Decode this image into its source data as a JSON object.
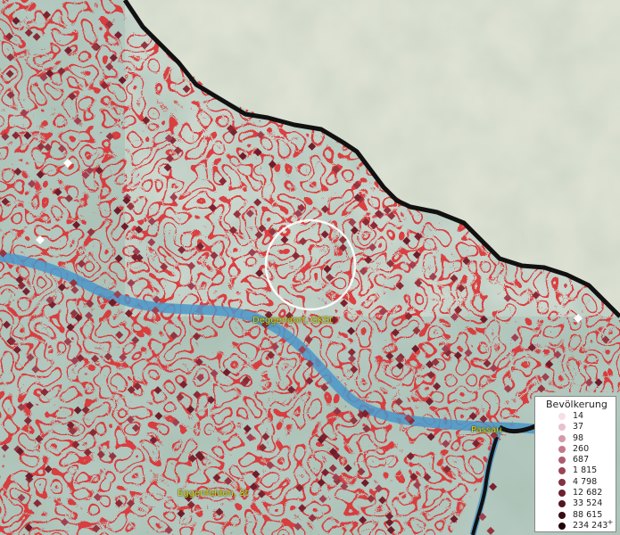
{
  "map": {
    "colors": {
      "relief_light": "#b9cbbd",
      "relief_dark": "#7f9a8e",
      "mountain_light": "#e4e0cc",
      "river": "#4a96c9",
      "boundary": "#e0282a",
      "border": "#111111",
      "marker": "#8a2a36",
      "label": "#d9d21a"
    },
    "labels": [
      {
        "id": "deggendorf",
        "text": "Deggendorf, GKSt"
      },
      {
        "id": "passau",
        "text": "Passau"
      },
      {
        "id": "eggenfelden",
        "text": "Eggenfelden, St"
      }
    ]
  },
  "legend": {
    "title": "Bevölkerung",
    "classes": [
      {
        "label": "14",
        "color": "#f7dfe6"
      },
      {
        "label": "37",
        "color": "#e9c0cc"
      },
      {
        "label": "98",
        "color": "#d59aa9"
      },
      {
        "label": "260",
        "color": "#c27a8c"
      },
      {
        "label": "687",
        "color": "#ad5d70"
      },
      {
        "label": "1 815",
        "color": "#994556"
      },
      {
        "label": "4 798",
        "color": "#823242"
      },
      {
        "label": "12 682",
        "color": "#6b2130"
      },
      {
        "label": "33 524",
        "color": "#521520"
      },
      {
        "label": "88 615",
        "color": "#380b13"
      },
      {
        "label": "234 243",
        "color": "#1f0408",
        "suffix": "+"
      }
    ]
  }
}
